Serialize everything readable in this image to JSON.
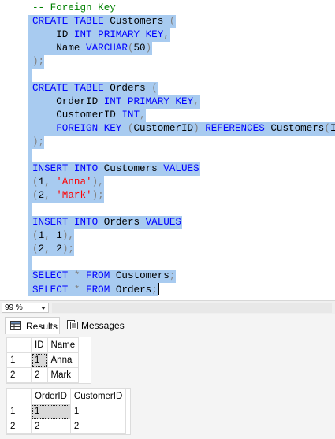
{
  "editor": {
    "lines": [
      [
        {
          "t": "-- Foreign Key",
          "c": "cm"
        }
      ],
      [
        {
          "t": "CREATE",
          "c": "kw"
        },
        {
          "t": " ",
          "c": "id"
        },
        {
          "t": "TABLE",
          "c": "kw"
        },
        {
          "t": " Customers ",
          "c": "id"
        },
        {
          "t": "(",
          "c": "op"
        }
      ],
      [
        {
          "t": "    ID ",
          "c": "id"
        },
        {
          "t": "INT PRIMARY KEY",
          "c": "kw"
        },
        {
          "t": ",",
          "c": "op"
        }
      ],
      [
        {
          "t": "    Name ",
          "c": "id"
        },
        {
          "t": "VARCHAR",
          "c": "kw"
        },
        {
          "t": "(",
          "c": "op"
        },
        {
          "t": "50",
          "c": "id"
        },
        {
          "t": ")",
          "c": "op"
        }
      ],
      [
        {
          "t": ");",
          "c": "op"
        }
      ],
      [],
      [
        {
          "t": "CREATE",
          "c": "kw"
        },
        {
          "t": " ",
          "c": "id"
        },
        {
          "t": "TABLE",
          "c": "kw"
        },
        {
          "t": " Orders ",
          "c": "id"
        },
        {
          "t": "(",
          "c": "op"
        }
      ],
      [
        {
          "t": "    OrderID ",
          "c": "id"
        },
        {
          "t": "INT PRIMARY KEY",
          "c": "kw"
        },
        {
          "t": ",",
          "c": "op"
        }
      ],
      [
        {
          "t": "    CustomerID ",
          "c": "id"
        },
        {
          "t": "INT",
          "c": "kw"
        },
        {
          "t": ",",
          "c": "op"
        }
      ],
      [
        {
          "t": "    ",
          "c": "id"
        },
        {
          "t": "FOREIGN KEY",
          "c": "kw"
        },
        {
          "t": " (",
          "c": "op"
        },
        {
          "t": "CustomerID",
          "c": "id"
        },
        {
          "t": ") ",
          "c": "op"
        },
        {
          "t": "REFERENCES",
          "c": "kw"
        },
        {
          "t": " Customers",
          "c": "id"
        },
        {
          "t": "(",
          "c": "op"
        },
        {
          "t": "ID",
          "c": "id"
        },
        {
          "t": ")",
          "c": "op"
        }
      ],
      [
        {
          "t": ");",
          "c": "op"
        }
      ],
      [],
      [
        {
          "t": "INSERT",
          "c": "kw"
        },
        {
          "t": " ",
          "c": "id"
        },
        {
          "t": "INTO",
          "c": "kw"
        },
        {
          "t": " Customers ",
          "c": "id"
        },
        {
          "t": "VALUES",
          "c": "kw"
        }
      ],
      [
        {
          "t": "(",
          "c": "op"
        },
        {
          "t": "1",
          "c": "id"
        },
        {
          "t": ", ",
          "c": "op"
        },
        {
          "t": "'Anna'",
          "c": "st"
        },
        {
          "t": "),",
          "c": "op"
        }
      ],
      [
        {
          "t": "(",
          "c": "op"
        },
        {
          "t": "2",
          "c": "id"
        },
        {
          "t": ", ",
          "c": "op"
        },
        {
          "t": "'Mark'",
          "c": "st"
        },
        {
          "t": ");",
          "c": "op"
        }
      ],
      [],
      [
        {
          "t": "INSERT",
          "c": "kw"
        },
        {
          "t": " ",
          "c": "id"
        },
        {
          "t": "INTO",
          "c": "kw"
        },
        {
          "t": " Orders ",
          "c": "id"
        },
        {
          "t": "VALUES",
          "c": "kw"
        }
      ],
      [
        {
          "t": "(",
          "c": "op"
        },
        {
          "t": "1",
          "c": "id"
        },
        {
          "t": ", ",
          "c": "op"
        },
        {
          "t": "1",
          "c": "id"
        },
        {
          "t": "),",
          "c": "op"
        }
      ],
      [
        {
          "t": "(",
          "c": "op"
        },
        {
          "t": "2",
          "c": "id"
        },
        {
          "t": ", ",
          "c": "op"
        },
        {
          "t": "2",
          "c": "id"
        },
        {
          "t": ");",
          "c": "op"
        }
      ],
      [],
      [
        {
          "t": "SELECT",
          "c": "kw"
        },
        {
          "t": " * ",
          "c": "op"
        },
        {
          "t": "FROM",
          "c": "kw"
        },
        {
          "t": " Customers",
          "c": "id"
        },
        {
          "t": ";",
          "c": "op"
        }
      ],
      [
        {
          "t": "SELECT",
          "c": "kw"
        },
        {
          "t": " * ",
          "c": "op"
        },
        {
          "t": "FROM",
          "c": "kw"
        },
        {
          "t": " Orders",
          "c": "id"
        },
        {
          "t": ";",
          "c": "op"
        }
      ]
    ]
  },
  "zoom": {
    "value": "99 %"
  },
  "tabs": {
    "results": "Results",
    "messages": "Messages"
  },
  "grids": [
    {
      "headers": [
        "",
        "ID",
        "Name"
      ],
      "rows": [
        [
          "1",
          "1",
          "Anna"
        ],
        [
          "2",
          "2",
          "Mark"
        ]
      ]
    },
    {
      "headers": [
        "",
        "OrderID",
        "CustomerID"
      ],
      "rows": [
        [
          "1",
          "1",
          "1"
        ],
        [
          "2",
          "2",
          "2"
        ]
      ]
    }
  ]
}
